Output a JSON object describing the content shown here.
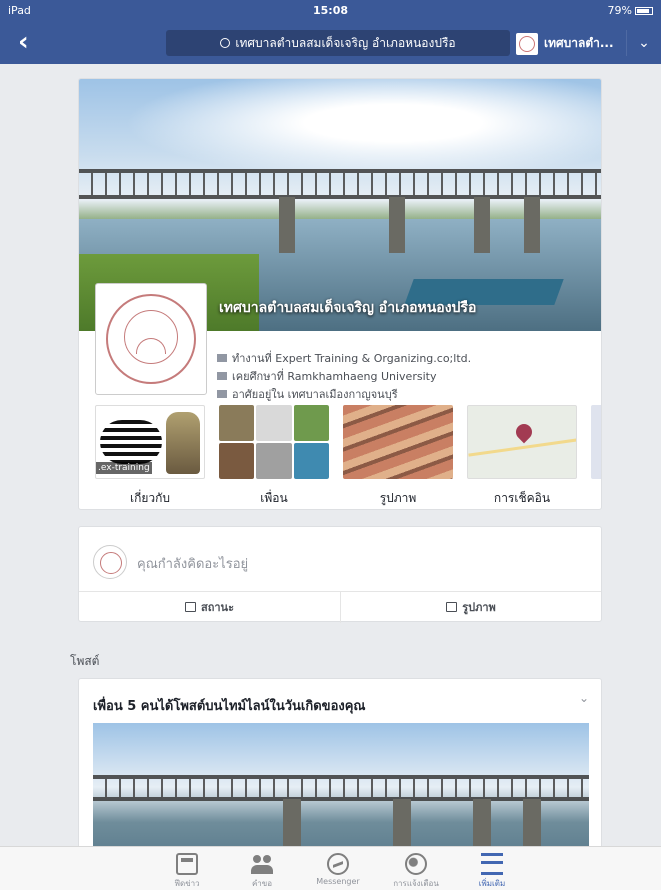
{
  "status_bar": {
    "device": "iPad",
    "time": "15:08",
    "battery": "79%"
  },
  "navbar": {
    "search_text": "เทศบาลตำบลสมเด็จเจริญ อำเภอหนองปรือ",
    "page_name_short": "เทศบาลตำ..."
  },
  "profile": {
    "name": "เทศบาลตำบลสมเด็จเจริญ อำเภอหนองปรือ",
    "work": "ทำงานที่ Expert Training & Organizing.co;ltd.",
    "education": "เคยศึกษาที่ Ramkhamhaeng University",
    "lives_in": "อาศัยอยู่ใน เทศบาลเมืองกาญจนบุรี",
    "about_tile_text": ".ex-training",
    "tiles": [
      {
        "label": "เกี่ยวกับ"
      },
      {
        "label": "เพื่อน"
      },
      {
        "label": "รูปภาพ"
      },
      {
        "label": "การเช็คอิน"
      }
    ]
  },
  "composer": {
    "placeholder": "คุณกำลังคิดอะไรอยู่",
    "status_label": "สถานะ",
    "photo_label": "รูปภาพ"
  },
  "posts_section": {
    "title": "โพสต์"
  },
  "post": {
    "title": "เพื่อน 5 คนได้โพสต์บนไทม์ไลน์ในวันเกิดของคุณ"
  },
  "tabbar": {
    "items": [
      {
        "label": "ฟีดข่าว",
        "icon": "news-feed-icon"
      },
      {
        "label": "คำขอ",
        "icon": "friends-icon"
      },
      {
        "label": "Messenger",
        "icon": "messenger-icon"
      },
      {
        "label": "การแจ้งเตือน",
        "icon": "notifications-globe-icon"
      },
      {
        "label": "เพิ่มเติม",
        "icon": "menu-icon"
      }
    ]
  },
  "colors": {
    "brand": "#3b5998",
    "active_tab": "#4267b2"
  }
}
